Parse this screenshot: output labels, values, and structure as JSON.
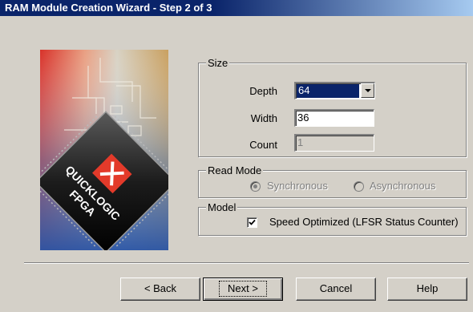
{
  "window": {
    "title": "RAM Module Creation Wizard - Step 2 of 3"
  },
  "image": {
    "icon": "quicklogic-fpga-chip-image",
    "chip_text_line1": "QUICKLOGIC",
    "chip_text_line2": "FPGA"
  },
  "size": {
    "legend": "Size",
    "depth_label": "Depth",
    "depth_value": "64",
    "width_label": "Width",
    "width_value": "36",
    "count_label": "Count",
    "count_value": "1"
  },
  "read_mode": {
    "legend": "Read Mode",
    "synchronous_label": "Synchronous",
    "asynchronous_label": "Asynchronous",
    "selected": "Synchronous"
  },
  "model": {
    "legend": "Model",
    "speed_optimized_label": "Speed Optimized (LFSR Status Counter)",
    "checked": true
  },
  "buttons": {
    "back": "< Back",
    "next": "Next >",
    "cancel": "Cancel",
    "help": "Help"
  },
  "colors": {
    "face": "#d4d0c8",
    "title_start": "#0a246a",
    "title_end": "#a6caf0",
    "selection": "#0a246a"
  }
}
